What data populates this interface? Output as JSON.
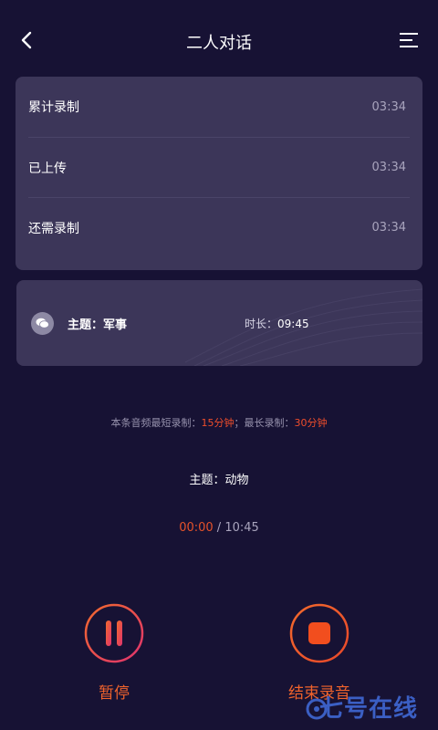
{
  "header": {
    "title": "二人对话"
  },
  "stats": [
    {
      "label": "累计录制",
      "value": "03:34"
    },
    {
      "label": "已上传",
      "value": "03:34"
    },
    {
      "label": "还需录制",
      "value": "03:34"
    }
  ],
  "topic_card": {
    "topic": "主题：军事",
    "duration_label": "时长：",
    "duration_value": "09:45"
  },
  "limits": {
    "prefix": "本条音频最短录制：",
    "min": "15分钟",
    "sep": "；最长录制：",
    "max": "30分钟"
  },
  "current_topic": "主题：动物",
  "timer": {
    "elapsed": "00:00",
    "separator": " / ",
    "total": "10:45"
  },
  "controls": {
    "pause_label": "暂停",
    "stop_label": "结束录音"
  },
  "watermark": {
    "text": "七号在线"
  },
  "colors": {
    "background": "#171234",
    "card": "#3c3659",
    "accent": "#f04e2b"
  }
}
